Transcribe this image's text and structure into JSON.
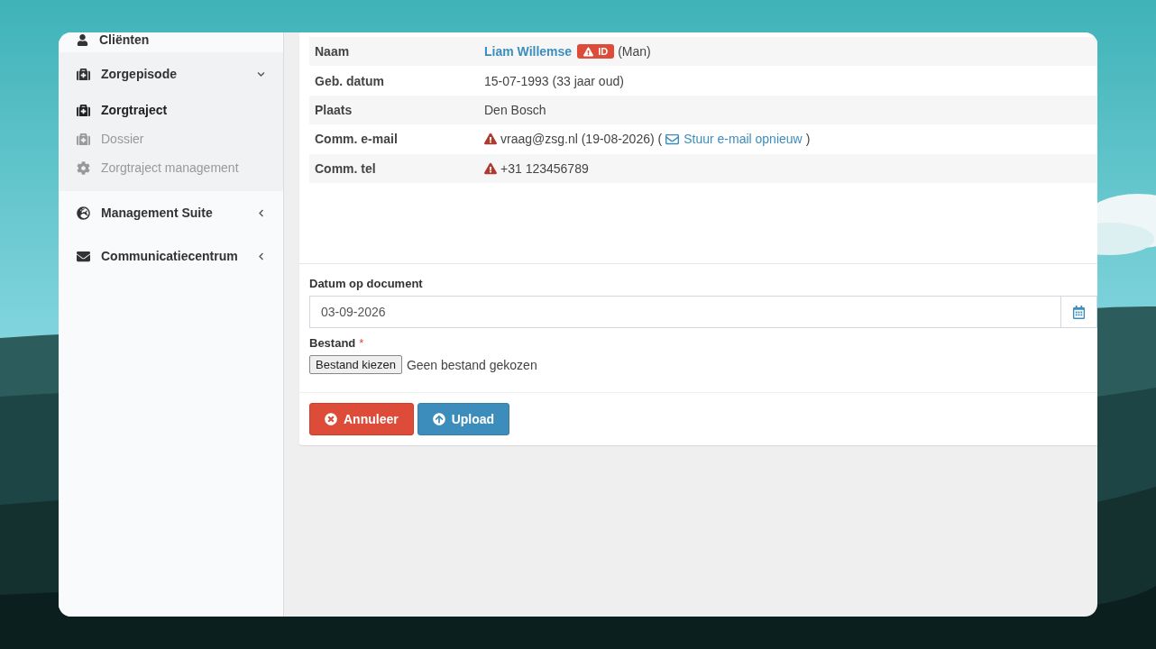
{
  "sidebar": {
    "items": [
      {
        "label": "Cliënten",
        "kind": "link"
      },
      {
        "label": "Zorgepisode",
        "kind": "group",
        "expanded": true,
        "children": [
          {
            "label": "Zorgtraject",
            "selected": true
          },
          {
            "label": "Dossier",
            "selected": false
          },
          {
            "label": "Zorgtraject management",
            "selected": false
          }
        ]
      },
      {
        "label": "Management Suite",
        "kind": "group",
        "expanded": false
      },
      {
        "label": "Communicatiecentrum",
        "kind": "group",
        "expanded": false
      }
    ]
  },
  "details": {
    "rows": [
      {
        "label": "Naam",
        "kind": "name",
        "link": "Liam Willemse",
        "badge": "ID",
        "suffix": "(Man)"
      },
      {
        "label": "Geb. datum",
        "kind": "text",
        "value": "15-07-1993 (33 jaar oud)"
      },
      {
        "label": "Plaats",
        "kind": "text",
        "value": "Den Bosch"
      },
      {
        "label": "Comm. e-mail",
        "kind": "warning",
        "value": "vraag@zsg.nl (19-08-2026) (",
        "link": "Stuur e-mail opnieuw",
        "suffix": ")"
      },
      {
        "label": "Comm. tel",
        "kind": "warning",
        "value": "+31 123456789"
      }
    ]
  },
  "form": {
    "date_field": {
      "label": "Datum op document",
      "value": "03-09-2026"
    },
    "file_field": {
      "label": "Bestand",
      "required_mark": "*",
      "button": "Bestand kiezen",
      "status": "Geen bestand gekozen"
    },
    "buttons": [
      {
        "label": "Annuleer",
        "kind": "cancel"
      },
      {
        "label": "Upload",
        "kind": "upload"
      }
    ]
  }
}
